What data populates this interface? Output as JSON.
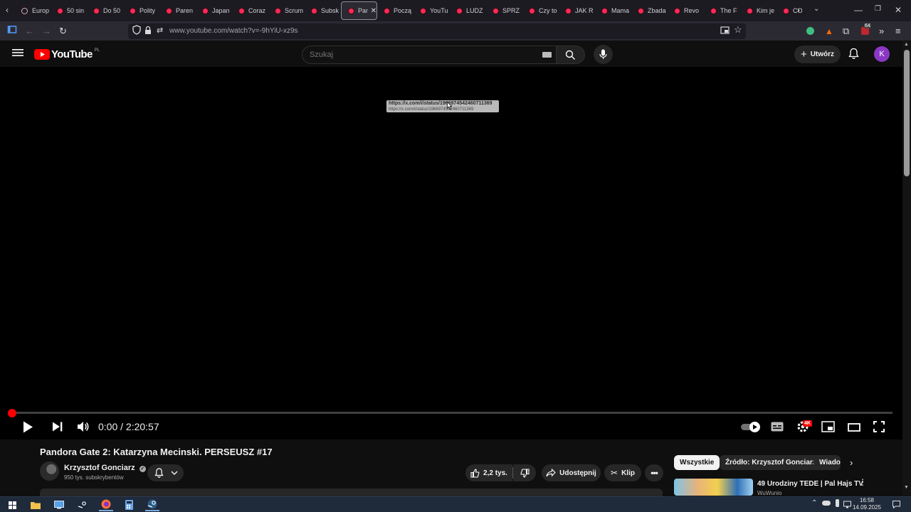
{
  "browser": {
    "tabs": [
      {
        "label": "Europ",
        "favicon": "globe-icon"
      },
      {
        "label": "50 sin",
        "favicon": "youtube-icon"
      },
      {
        "label": "Do 50",
        "favicon": "youtube-icon"
      },
      {
        "label": "Polity",
        "favicon": "youtube-icon"
      },
      {
        "label": "Paren",
        "favicon": "youtube-icon"
      },
      {
        "label": "Japan",
        "favicon": "youtube-icon"
      },
      {
        "label": "Coraz",
        "favicon": "youtube-icon"
      },
      {
        "label": "Scrum",
        "favicon": "youtube-icon"
      },
      {
        "label": "Subsk",
        "favicon": "youtube-icon"
      },
      {
        "label": "Pan",
        "favicon": "youtube-icon",
        "active": true
      },
      {
        "label": "Począ",
        "favicon": "youtube-icon"
      },
      {
        "label": "YouTu",
        "favicon": "youtube-icon"
      },
      {
        "label": "LUDZ",
        "favicon": "youtube-icon"
      },
      {
        "label": "SPRZ",
        "favicon": "youtube-icon"
      },
      {
        "label": "Czy to",
        "favicon": "youtube-icon"
      },
      {
        "label": "JAK R",
        "favicon": "youtube-icon"
      },
      {
        "label": "Mama",
        "favicon": "youtube-icon"
      },
      {
        "label": "Zbada",
        "favicon": "youtube-icon"
      },
      {
        "label": "Revo",
        "favicon": "youtube-icon"
      },
      {
        "label": "The F",
        "favicon": "youtube-icon"
      },
      {
        "label": "Kim je",
        "favicon": "youtube-icon"
      },
      {
        "label": "CO",
        "favicon": "youtube-icon"
      }
    ],
    "active_tab_close": "✕",
    "url": "www.youtube.com/watch?v=-9hYiU-xz9s",
    "extensions_badge": "64"
  },
  "youtube": {
    "logo_text": "YouTube",
    "logo_region": "PL",
    "search_placeholder": "Szukaj",
    "create_label": "Utwórz",
    "avatar_letter": "K"
  },
  "player": {
    "tooltip_main": "https://x.com/i/status/1966974542460711369",
    "tooltip_sub": "https://x.com/i/status/1966974542460711369",
    "current_time": "0:00",
    "duration": "2:20:57",
    "time_display": "0:00 / 2:20:57",
    "progress_fraction": 0.0,
    "quality_badge": "4K"
  },
  "video": {
    "title": "Pandora Gate 2: Katarzyna Mecinski. PERSEUSZ #17",
    "channel_name": "Krzysztof Gonciarz",
    "verified_icon": "verified-check-icon",
    "subscribers": "950 tys. subskrybentów",
    "likes": "2,2 tys.",
    "share_label": "Udostępnij",
    "clip_label": "Klip"
  },
  "sidebar": {
    "chips": [
      "Wszystkie",
      "Źródło: Krzysztof Gonciarz",
      "Wiadom"
    ],
    "recommendation": {
      "title": "49 Urodziny TEDE | Pal Hajs TV",
      "channel": "WuWunio"
    }
  },
  "taskbar": {
    "time": "16:58",
    "date": "14.09.2025"
  },
  "colors": {
    "youtube_red": "#ff0000",
    "avatar_purple": "#8a38c4",
    "background": "#0f0f0f"
  }
}
